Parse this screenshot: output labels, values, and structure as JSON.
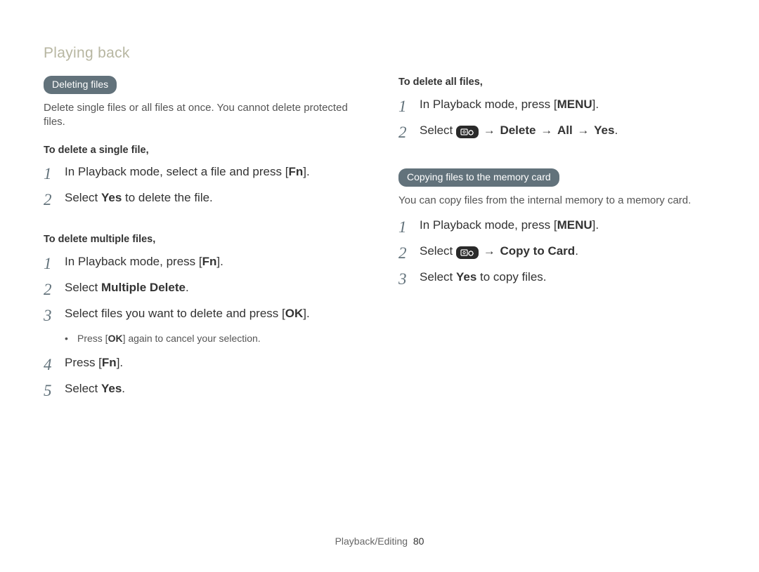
{
  "section_title": "Playing back",
  "left": {
    "pill": "Deleting files",
    "desc": "Delete single files or all files at once. You cannot delete protected files.",
    "single": {
      "subhead": "To delete a single file,",
      "step1_prefix": "In Playback mode, select a file and press [",
      "step1_key": "Fn",
      "step1_suffix": "].",
      "step2_prefix": "Select ",
      "step2_bold": "Yes",
      "step2_suffix": " to delete the file."
    },
    "multi": {
      "subhead": "To delete multiple files,",
      "step1_prefix": "In Playback mode, press [",
      "step1_key": "Fn",
      "step1_suffix": "].",
      "step2_prefix": "Select ",
      "step2_bold": "Multiple Delete",
      "step2_suffix": ".",
      "step3_prefix": "Select files you want to delete and press [",
      "step3_key": "OK",
      "step3_suffix": "].",
      "bullet_prefix": "Press [",
      "bullet_key": "OK",
      "bullet_suffix": "] again to cancel your selection.",
      "step4_prefix": "Press [",
      "step4_key": "Fn",
      "step4_suffix": "].",
      "step5_prefix": "Select ",
      "step5_bold": "Yes",
      "step5_suffix": "."
    }
  },
  "right": {
    "all": {
      "subhead": "To delete all files,",
      "step1_prefix": "In Playback mode, press [",
      "step1_key": "MENU",
      "step1_suffix": "].",
      "step2_prefix": "Select ",
      "step2_b1": "Delete",
      "step2_b2": "All",
      "step2_b3": "Yes",
      "step2_end": "."
    },
    "copy": {
      "pill": "Copying files to the memory card",
      "desc": "You can copy files from the internal memory to a memory card.",
      "step1_prefix": "In Playback mode, press [",
      "step1_key": "MENU",
      "step1_suffix": "].",
      "step2_prefix": "Select ",
      "step2_bold": "Copy to Card",
      "step2_suffix": ".",
      "step3_prefix": "Select ",
      "step3_bold": "Yes",
      "step3_suffix": " to copy files."
    }
  },
  "arrow": "→",
  "nums": {
    "n1": "1",
    "n2": "2",
    "n3": "3",
    "n4": "4",
    "n5": "5"
  },
  "footer": {
    "section": "Playback/Editing",
    "page": "80"
  }
}
